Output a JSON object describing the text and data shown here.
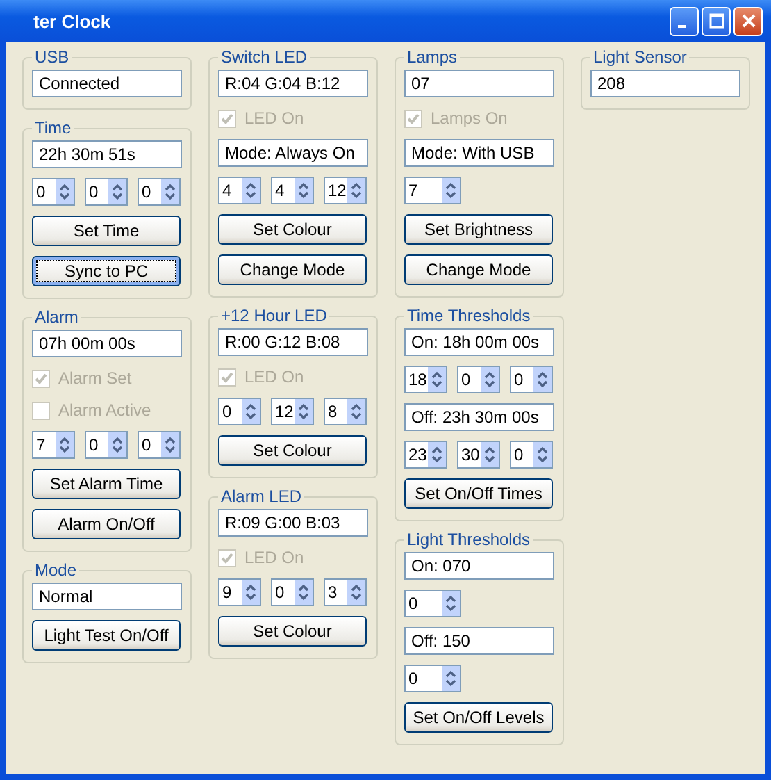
{
  "window": {
    "title": "ter Clock"
  },
  "columns": [
    {
      "groups": [
        {
          "title": "USB",
          "items": [
            {
              "kind": "field",
              "value": "Connected"
            }
          ]
        },
        {
          "title": "Time",
          "items": [
            {
              "kind": "field",
              "value": "22h 30m 51s"
            },
            {
              "kind": "spinners",
              "values": [
                "0",
                "0",
                "0"
              ]
            },
            {
              "kind": "button",
              "label": "Set Time",
              "focused": false
            },
            {
              "kind": "button",
              "label": "Sync to PC",
              "focused": true
            }
          ]
        },
        {
          "title": "Alarm",
          "items": [
            {
              "kind": "field",
              "value": "07h 00m 00s"
            },
            {
              "kind": "checkbox",
              "label": "Alarm Set",
              "checked": true,
              "disabled": true
            },
            {
              "kind": "checkbox",
              "label": "Alarm Active",
              "checked": false,
              "disabled": true
            },
            {
              "kind": "spinners",
              "values": [
                "7",
                "0",
                "0"
              ]
            },
            {
              "kind": "button",
              "label": "Set Alarm Time",
              "focused": false
            },
            {
              "kind": "button",
              "label": "Alarm On/Off",
              "focused": false
            }
          ]
        },
        {
          "title": "Mode",
          "items": [
            {
              "kind": "field",
              "value": "Normal"
            },
            {
              "kind": "button",
              "label": "Light Test On/Off",
              "focused": false
            }
          ]
        }
      ]
    },
    {
      "groups": [
        {
          "title": "Switch LED",
          "items": [
            {
              "kind": "field",
              "value": "R:04  G:04  B:12"
            },
            {
              "kind": "checkbox",
              "label": "LED On",
              "checked": true,
              "disabled": true
            },
            {
              "kind": "field",
              "value": "Mode: Always On"
            },
            {
              "kind": "spinners",
              "values": [
                "4",
                "4",
                "12"
              ]
            },
            {
              "kind": "button",
              "label": "Set Colour",
              "focused": false
            },
            {
              "kind": "button",
              "label": "Change Mode",
              "focused": false
            }
          ]
        },
        {
          "title": "+12 Hour LED",
          "items": [
            {
              "kind": "field",
              "value": "R:00  G:12  B:08"
            },
            {
              "kind": "checkbox",
              "label": "LED On",
              "checked": true,
              "disabled": true
            },
            {
              "kind": "spinners",
              "values": [
                "0",
                "12",
                "8"
              ]
            },
            {
              "kind": "button",
              "label": "Set Colour",
              "focused": false
            }
          ]
        },
        {
          "title": "Alarm LED",
          "items": [
            {
              "kind": "field",
              "value": "R:09  G:00  B:03"
            },
            {
              "kind": "checkbox",
              "label": "LED On",
              "checked": true,
              "disabled": true
            },
            {
              "kind": "spinners",
              "values": [
                "9",
                "0",
                "3"
              ]
            },
            {
              "kind": "button",
              "label": "Set Colour",
              "focused": false
            }
          ]
        }
      ]
    },
    {
      "groups": [
        {
          "title": "Lamps",
          "items": [
            {
              "kind": "field",
              "value": "07"
            },
            {
              "kind": "checkbox",
              "label": "Lamps On",
              "checked": true,
              "disabled": true
            },
            {
              "kind": "field",
              "value": "Mode: With USB"
            },
            {
              "kind": "spinners",
              "values": [
                "7"
              ]
            },
            {
              "kind": "button",
              "label": "Set Brightness",
              "focused": false
            },
            {
              "kind": "button",
              "label": "Change Mode",
              "focused": false
            }
          ]
        },
        {
          "title": "Time Thresholds",
          "items": [
            {
              "kind": "field",
              "value": "On: 18h 00m 00s"
            },
            {
              "kind": "spinners",
              "values": [
                "18",
                "0",
                "0"
              ]
            },
            {
              "kind": "field",
              "value": "Off: 23h 30m 00s"
            },
            {
              "kind": "spinners",
              "values": [
                "23",
                "30",
                "0"
              ]
            },
            {
              "kind": "button",
              "label": "Set On/Off Times",
              "focused": false
            }
          ]
        },
        {
          "title": "Light Thresholds",
          "items": [
            {
              "kind": "field",
              "value": "On: 070"
            },
            {
              "kind": "spinners",
              "values": [
                "0"
              ]
            },
            {
              "kind": "field",
              "value": "Off: 150"
            },
            {
              "kind": "spinners",
              "values": [
                "0"
              ]
            },
            {
              "kind": "button",
              "label": "Set On/Off Levels",
              "focused": false
            }
          ]
        }
      ]
    },
    {
      "groups": [
        {
          "title": "Light Sensor",
          "items": [
            {
              "kind": "field",
              "value": "208"
            }
          ]
        }
      ]
    }
  ]
}
